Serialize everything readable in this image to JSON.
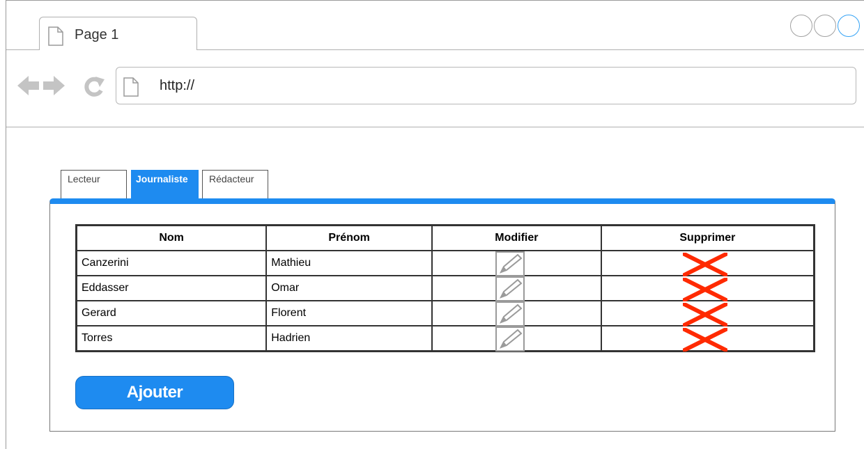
{
  "browser": {
    "tab_title": "Page 1",
    "url": "http://"
  },
  "app": {
    "tabs": [
      {
        "label": "Lecteur",
        "active": false
      },
      {
        "label": "Journaliste",
        "active": true
      },
      {
        "label": "Rédacteur",
        "active": false
      }
    ],
    "table": {
      "headers": [
        "Nom",
        "Prénom",
        "Modifier",
        "Supprimer"
      ],
      "rows": [
        {
          "nom": "Canzerini",
          "prenom": "Mathieu"
        },
        {
          "nom": "Eddasser",
          "prenom": "Omar"
        },
        {
          "nom": "Gerard",
          "prenom": "Florent"
        },
        {
          "nom": "Torres",
          "prenom": "Hadrien"
        }
      ],
      "edit_icon": "pencil-icon",
      "delete_icon": "red-x-icon"
    },
    "add_button_label": "Ajouter"
  },
  "colors": {
    "accent": "#1e8bf0",
    "delete": "#ff2a00",
    "window_active": "#35a3f5"
  }
}
